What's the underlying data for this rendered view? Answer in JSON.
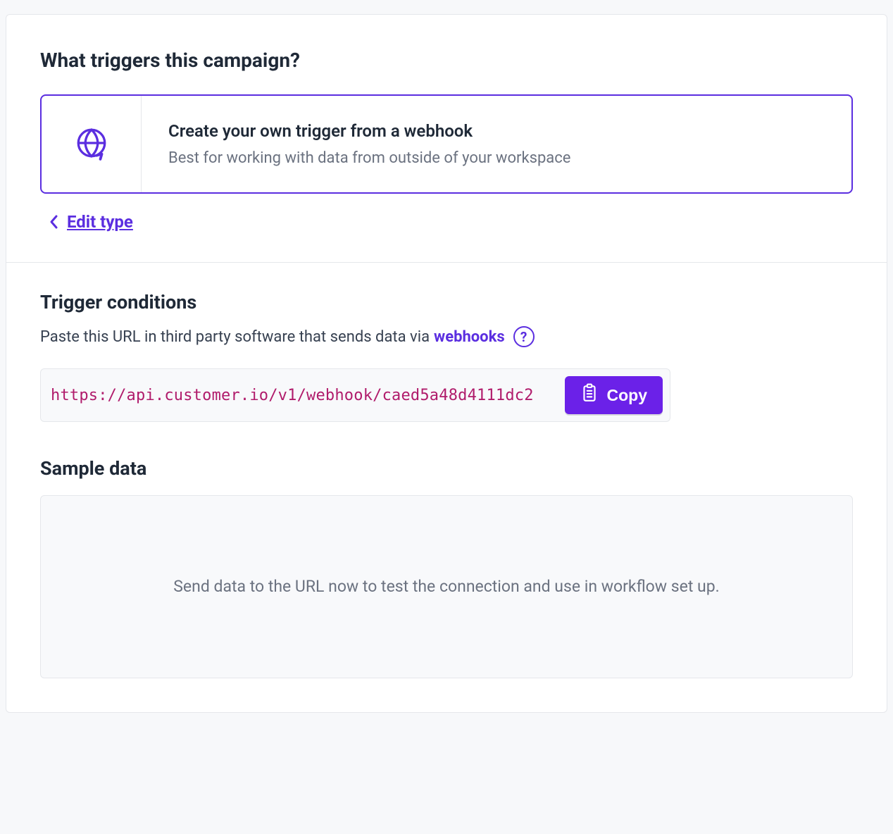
{
  "header": {
    "title": "What triggers this campaign?"
  },
  "trigger": {
    "title": "Create your own trigger from a webhook",
    "subtitle": "Best for working with data from outside of your workspace",
    "edit_label": "Edit type"
  },
  "conditions": {
    "title": "Trigger conditions",
    "desc_prefix": "Paste this URL in third party software that sends data via",
    "link_label": "webhooks",
    "help_glyph": "?",
    "url": "https://api.customer.io/v1/webhook/caed5a48d4111dc2",
    "copy_label": "Copy"
  },
  "sample": {
    "title": "Sample data",
    "placeholder": "Send data to the URL now to test the connection and use in workflow set up."
  }
}
